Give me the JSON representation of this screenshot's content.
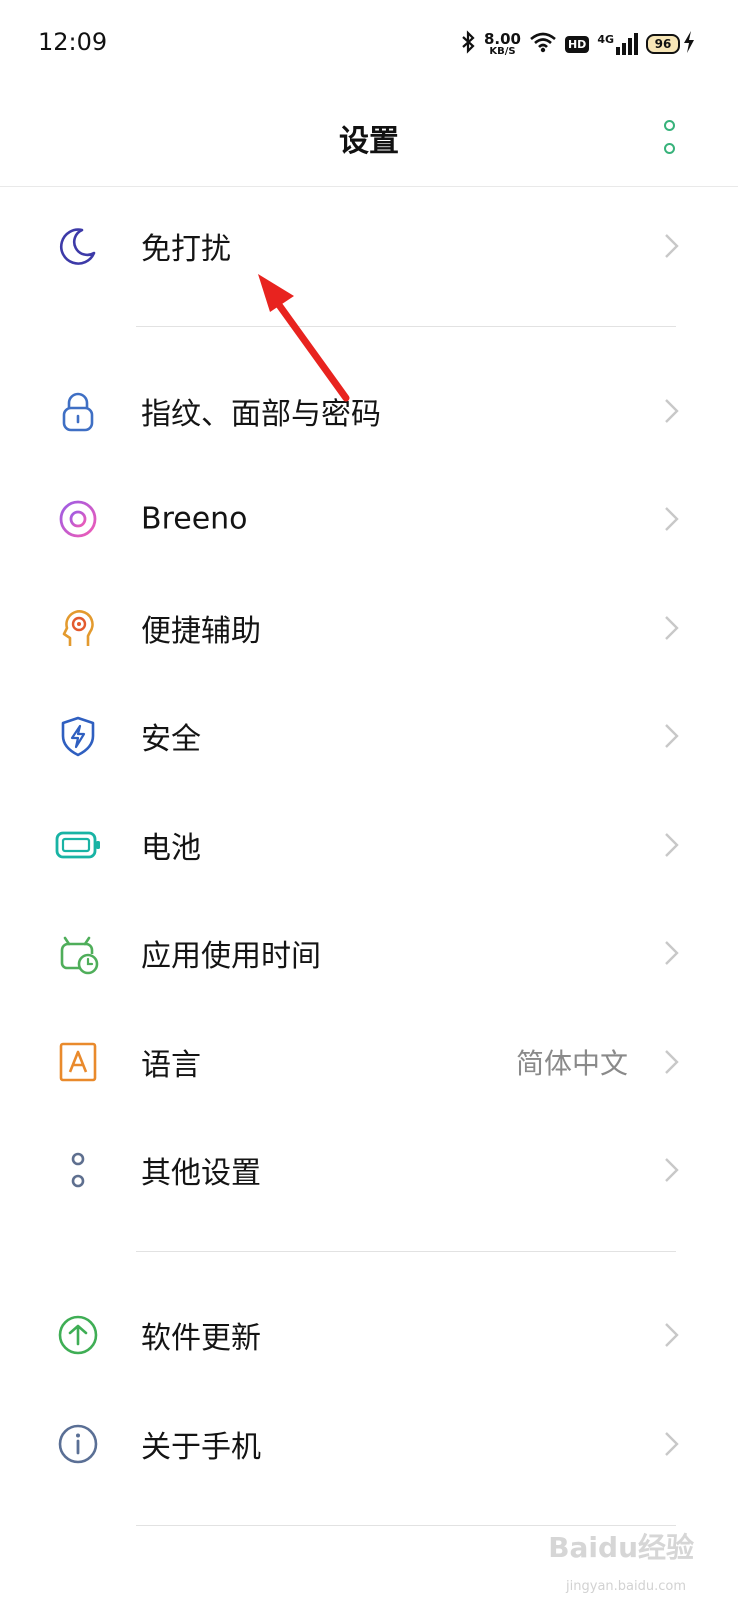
{
  "status_bar": {
    "time": "12:09",
    "net_speed_value": "8.00",
    "net_speed_unit": "KB/S",
    "hd_label": "HD",
    "network_type": "4G",
    "battery_level": "96",
    "icons": [
      "bluetooth-icon",
      "wifi-icon",
      "hd-icon",
      "signal-4g-icon",
      "battery-icon",
      "charging-icon"
    ]
  },
  "header": {
    "title": "设置",
    "more_icon": "more-vertical-dots-icon"
  },
  "settings": {
    "items": [
      {
        "label": "免打扰",
        "icon": "moon-icon"
      },
      {
        "label": "指纹、面部与密码",
        "icon": "lock-icon"
      },
      {
        "label": "Breeno",
        "icon": "breeno-ring-icon"
      },
      {
        "label": "便捷辅助",
        "icon": "head-assist-icon"
      },
      {
        "label": "安全",
        "icon": "shield-bolt-icon"
      },
      {
        "label": "电池",
        "icon": "battery-outline-icon"
      },
      {
        "label": "应用使用时间",
        "icon": "clock-robot-icon"
      },
      {
        "label": "语言",
        "icon": "letter-a-icon",
        "value": "简体中文"
      },
      {
        "label": "其他设置",
        "icon": "two-dots-icon"
      },
      {
        "label": "软件更新",
        "icon": "arrow-up-circle-icon"
      },
      {
        "label": "关于手机",
        "icon": "info-circle-icon"
      }
    ]
  },
  "annotation": {
    "color": "#e8231f"
  },
  "watermark": {
    "text": "Baidu经验",
    "sub": "jingyan.baidu.com"
  },
  "colors": {
    "accent_green": "#37b27a",
    "moon": "#3d3aa8",
    "lock": "#3f6fc4",
    "breeno": "#c25ac8",
    "assist": "#e39a2e",
    "security": "#2f5fc0",
    "battery": "#18b3a4",
    "app_time": "#4fae5a",
    "language": "#e98a2c",
    "other": "#5e6f8f",
    "update": "#3fae55",
    "about": "#5a6f95"
  }
}
